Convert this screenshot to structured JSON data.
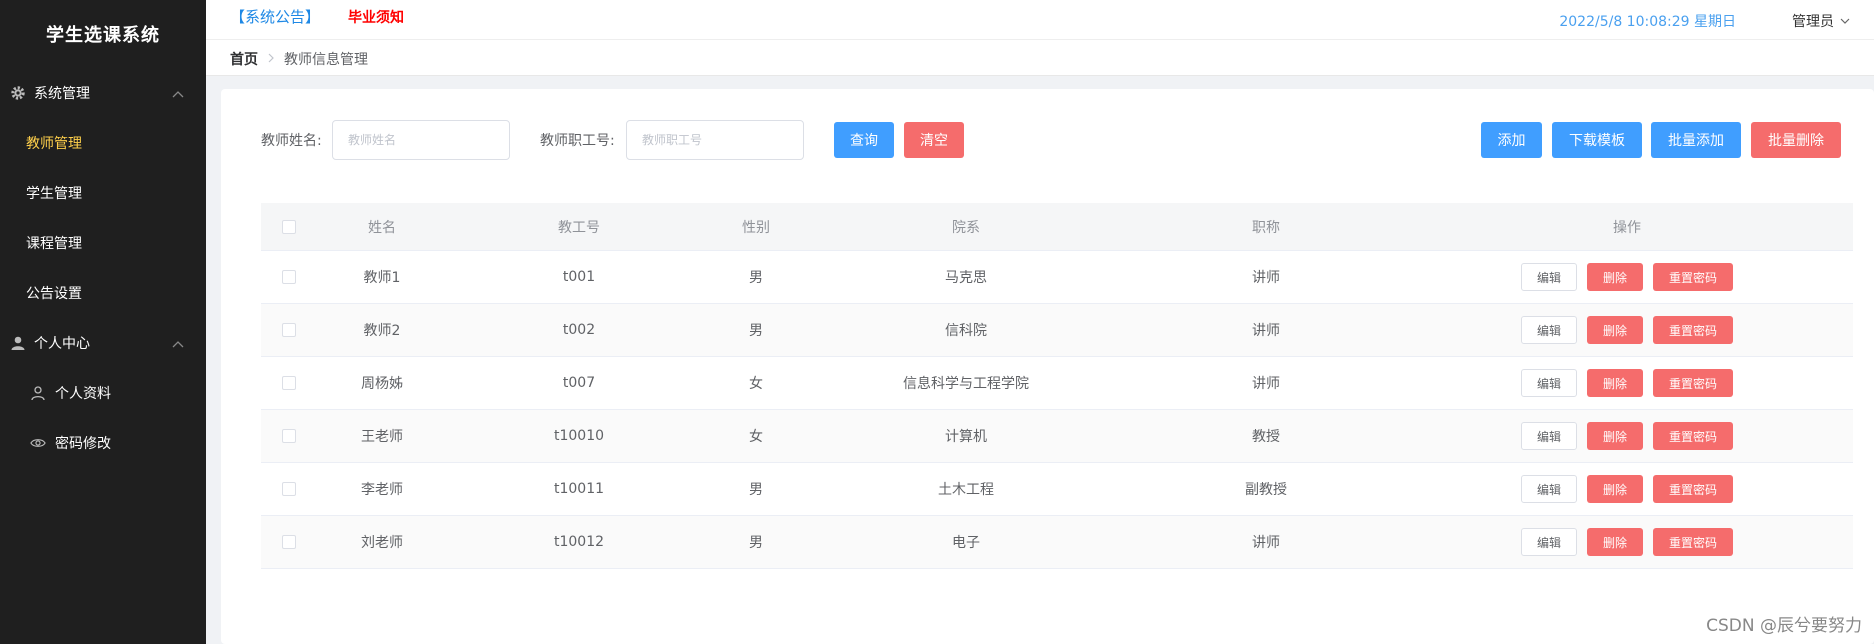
{
  "app": {
    "title": "学生选课系统"
  },
  "sidebar": {
    "groups": [
      {
        "label": "系统管理",
        "icon": "gear-icon",
        "items": [
          "教师管理",
          "学生管理",
          "课程管理",
          "公告设置"
        ]
      },
      {
        "label": "个人中心",
        "icon": "user-icon",
        "items": [
          "个人资料",
          "密码修改"
        ]
      }
    ],
    "active_item": "教师管理"
  },
  "header": {
    "notice_tag": "【系统公告】",
    "notice_text": "毕业须知",
    "datetime": "2022/5/8 10:08:29 星期日",
    "user": "管理员"
  },
  "breadcrumb": {
    "home": "首页",
    "current": "教师信息管理"
  },
  "search": {
    "name_label": "教师姓名:",
    "name_placeholder": "教师姓名",
    "no_label": "教师职工号:",
    "no_placeholder": "教师职工号",
    "query_button": "查询",
    "clear_button": "清空"
  },
  "toolbar": {
    "add_button": "添加",
    "download_button": "下载模板",
    "batch_add_button": "批量添加",
    "batch_delete_button": "批量删除"
  },
  "table": {
    "headers": {
      "name": "姓名",
      "no": "教工号",
      "gender": "性别",
      "dept": "院系",
      "title": "职称",
      "ops": "操作"
    },
    "rows": [
      {
        "name": "教师1",
        "no": "t001",
        "gender": "男",
        "dept": "马克思",
        "title": "讲师"
      },
      {
        "name": "教师2",
        "no": "t002",
        "gender": "男",
        "dept": "信科院",
        "title": "讲师"
      },
      {
        "name": "周杨姊",
        "no": "t007",
        "gender": "女",
        "dept": "信息科学与工程学院",
        "title": "讲师"
      },
      {
        "name": "王老师",
        "no": "t10010",
        "gender": "女",
        "dept": "计算机",
        "title": "教授"
      },
      {
        "name": "李老师",
        "no": "t10011",
        "gender": "男",
        "dept": "土木工程",
        "title": "副教授"
      },
      {
        "name": "刘老师",
        "no": "t10012",
        "gender": "男",
        "dept": "电子",
        "title": "讲师"
      }
    ],
    "row_actions": {
      "edit": "编辑",
      "delete": "删除",
      "reset": "重置密码"
    }
  },
  "watermark": "CSDN @辰兮要努力",
  "colors": {
    "sidebar_bg": "#1f1f1f",
    "active": "#ffd04b",
    "primary": "#409eff",
    "danger": "#f56c6c"
  }
}
